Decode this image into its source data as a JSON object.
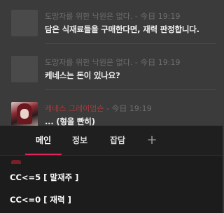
{
  "messages": [
    {
      "sender": "도망자를 위한 낙원은 없다.",
      "sep": " - ",
      "time": "今日 19:19",
      "text": "담은 식재료들을 구매한다면, 재력 판정합니다."
    },
    {
      "sender": "도망자를 위한 낙원은 없다.",
      "sep": " - ",
      "time": "今日 19:19",
      "text": "케네스는 돈이 있나요?"
    },
    {
      "sender": "케네스 그레이엄슨",
      "sep": " - ",
      "time": "今日 19:19",
      "text": "... (형을 빤히)"
    }
  ],
  "tabs": {
    "main": "메인",
    "info": "정보",
    "chat": "잡담",
    "add": "+"
  },
  "commands": [
    "CC<=5 [ 말재주 ]",
    "CC<=0 [ 재력 ]"
  ],
  "colors": {
    "accent": "#e2245c",
    "sender_highlight": "#a83a3a"
  }
}
